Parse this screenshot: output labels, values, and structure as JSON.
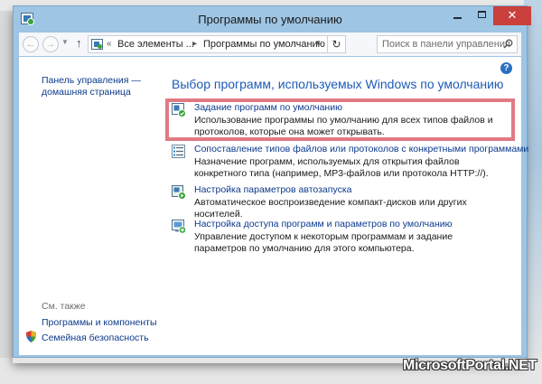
{
  "window": {
    "title": "Программы по умолчанию"
  },
  "navigation": {
    "breadcrumb_prefix": "«",
    "breadcrumb_1": "Все элементы ...",
    "breadcrumb_2": "Программы по умолчанию",
    "search_placeholder": "Поиск в панели управления"
  },
  "sidebar": {
    "home_link": "Панель управления — домашняя страница",
    "see_also": "См. также",
    "programs_link": "Программы и компоненты",
    "family_link": "Семейная безопасность"
  },
  "main": {
    "heading": "Выбор программ, используемых Windows по умолчанию",
    "items": [
      {
        "link": "Задание программ по умолчанию",
        "desc": "Использование программы по умолчанию для всех типов файлов и протоколов, которые она может открывать."
      },
      {
        "link": "Сопоставление типов файлов или протоколов с конкретными программами",
        "desc": "Назначение программ, используемых для открытия файлов конкретного типа (например, MP3-файлов или протокола HTTP://)."
      },
      {
        "link": "Настройка параметров автозапуска",
        "desc": "Автоматическое воспроизведение компакт-дисков или других носителей."
      },
      {
        "link": "Настройка доступа программ и параметров по умолчанию",
        "desc": "Управление доступом к некоторым программам и задание параметров по умолчанию для этого компьютера."
      }
    ]
  },
  "watermark": "MicrosoftPortal.NET",
  "colors": {
    "titlebar": "#9ec5e3",
    "close_button": "#c9403d",
    "link": "#0b3a8c",
    "heading": "#1e5bb8",
    "highlight": "#e07a83"
  }
}
